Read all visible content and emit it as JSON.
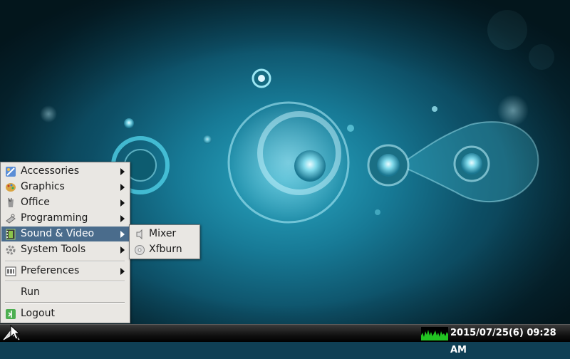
{
  "main_menu": {
    "items": [
      {
        "label": "Accessories",
        "icon": "accessories-icon",
        "submenu": true
      },
      {
        "label": "Graphics",
        "icon": "graphics-icon",
        "submenu": true
      },
      {
        "label": "Office",
        "icon": "office-icon",
        "submenu": true
      },
      {
        "label": "Programming",
        "icon": "programming-icon",
        "submenu": true
      },
      {
        "label": "Sound & Video",
        "icon": "sound-video-icon",
        "submenu": true,
        "active": true
      },
      {
        "label": "System Tools",
        "icon": "system-tools-icon",
        "submenu": true
      },
      {
        "label": "Preferences",
        "icon": "preferences-icon",
        "submenu": true
      },
      {
        "label": "Run",
        "icon": "",
        "submenu": false
      },
      {
        "label": "Logout",
        "icon": "logout-icon",
        "submenu": false
      }
    ]
  },
  "sub_menu": {
    "items": [
      {
        "label": "Mixer",
        "icon": "mixer-icon"
      },
      {
        "label": "Xfburn",
        "icon": "xfburn-icon"
      }
    ]
  },
  "taskbar": {
    "clock": "2015/07/25(6) 09:28 AM",
    "start_icon": "start-menu-icon",
    "cpu_monitor_icon": "cpu-monitor-icon"
  },
  "colors": {
    "menu_bg": "#e9e7e3",
    "menu_highlight": "#4a6c8c",
    "taskbar_bg": "#111111",
    "cpu_graph": "#22c422"
  }
}
